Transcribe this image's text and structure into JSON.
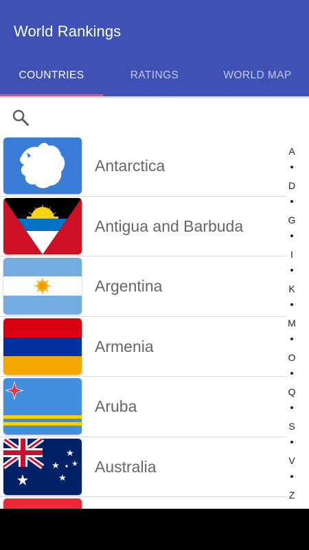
{
  "app": {
    "title": "World Rankings",
    "accent_color": "#3f51b5",
    "indicator_color": "#ff4081"
  },
  "tabs": [
    {
      "label": "COUNTRIES",
      "active": true
    },
    {
      "label": "RATINGS",
      "active": false
    },
    {
      "label": "WORLD MAP",
      "active": false
    }
  ],
  "search": {
    "icon": "search-icon"
  },
  "countries": [
    {
      "name": "Antarctica",
      "flag": "antarctica-flag"
    },
    {
      "name": "Antigua and Barbuda",
      "flag": "antigua-flag"
    },
    {
      "name": "Argentina",
      "flag": "argentina-flag"
    },
    {
      "name": "Armenia",
      "flag": "armenia-flag"
    },
    {
      "name": "Aruba",
      "flag": "aruba-flag"
    },
    {
      "name": "Australia",
      "flag": "australia-flag"
    }
  ],
  "alphabet_index": [
    "A",
    "D",
    "G",
    "I",
    "K",
    "M",
    "O",
    "Q",
    "S",
    "V",
    "Z"
  ]
}
